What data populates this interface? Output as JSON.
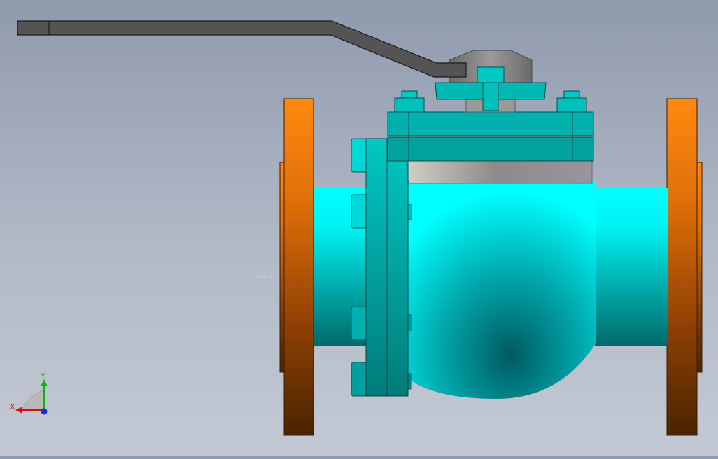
{
  "viewport": {
    "background_top": "#8f9aad",
    "background_bottom": "#c3c9d4"
  },
  "model": {
    "colors": {
      "body_cyan": "#00ffff",
      "body_teal": "#00a8a4",
      "flange_orange": "#ff8a10",
      "flange_dark": "#4a2400",
      "handle_gray": "#555555",
      "bonnet_gray": "#8a8a8a"
    }
  },
  "axis_triad": {
    "x_label": "X",
    "y_label": "Y",
    "x_color": "#d01010",
    "y_color": "#10b010",
    "z_color": "#1030e0"
  },
  "faint_label": "2026"
}
